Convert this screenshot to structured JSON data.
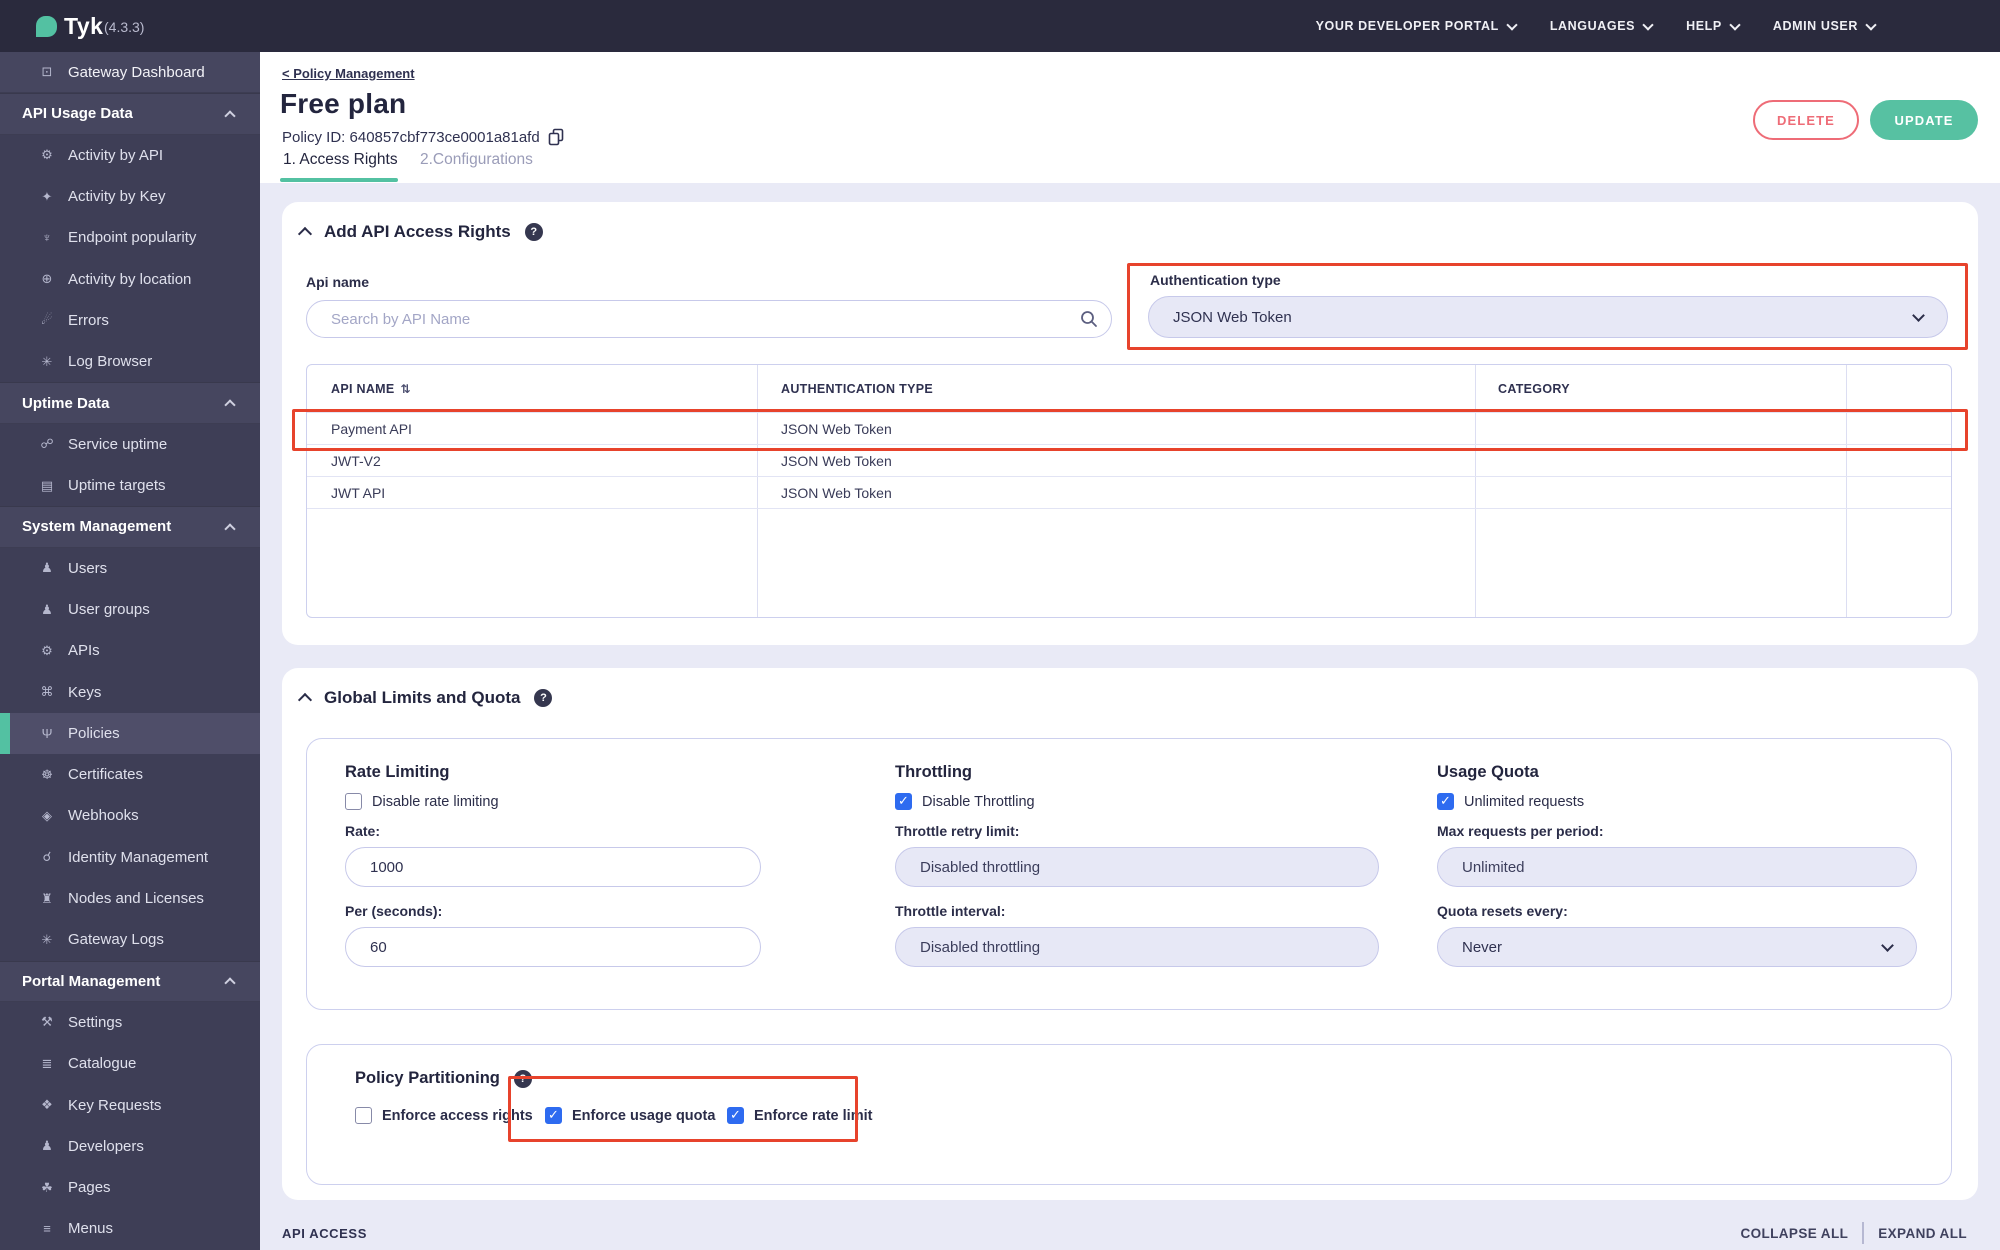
{
  "colors": {
    "accent_teal": "#53c1a2",
    "annotation_red": "#e7432c",
    "delete_red": "#ee6c77",
    "checkbox_blue": "#2e6bf0",
    "topbar": "#2a2a3d",
    "sidebar": "#3e3e56"
  },
  "brand": {
    "logo": "Tyk",
    "version": "(4.3.3)"
  },
  "topnav": {
    "items": [
      {
        "label": "YOUR DEVELOPER PORTAL"
      },
      {
        "label": "LANGUAGES"
      },
      {
        "label": "HELP"
      },
      {
        "label": "ADMIN USER"
      }
    ]
  },
  "sidebar": {
    "rows": [
      {
        "kind": "item",
        "label": "Gateway Dashboard",
        "icon": "monitor-icon",
        "glyph": "⊡"
      },
      {
        "kind": "section",
        "label": "API Usage Data"
      },
      {
        "kind": "sub",
        "label": "Activity by API",
        "icon": "gear-icon",
        "glyph": "⚙"
      },
      {
        "kind": "sub",
        "label": "Activity by Key",
        "icon": "key-icon",
        "glyph": "✦"
      },
      {
        "kind": "sub",
        "label": "Endpoint popularity",
        "icon": "branch-icon",
        "glyph": "♆"
      },
      {
        "kind": "sub",
        "label": "Activity by location",
        "icon": "globe-icon",
        "glyph": "⊕"
      },
      {
        "kind": "sub",
        "label": "Errors",
        "icon": "bomb-icon",
        "glyph": "☄"
      },
      {
        "kind": "sub",
        "label": "Log Browser",
        "icon": "bug-icon",
        "glyph": "✳"
      },
      {
        "kind": "section",
        "label": "Uptime Data"
      },
      {
        "kind": "sub",
        "label": "Service uptime",
        "icon": "link-icon",
        "glyph": "☍"
      },
      {
        "kind": "sub",
        "label": "Uptime targets",
        "icon": "list-icon",
        "glyph": "▤"
      },
      {
        "kind": "section",
        "label": "System Management"
      },
      {
        "kind": "sub",
        "label": "Users",
        "icon": "user-icon",
        "glyph": "♟"
      },
      {
        "kind": "sub",
        "label": "User groups",
        "icon": "users-icon",
        "glyph": "♟"
      },
      {
        "kind": "sub",
        "label": "APIs",
        "icon": "gears-icon",
        "glyph": "⚙"
      },
      {
        "kind": "sub",
        "label": "Keys",
        "icon": "network-icon",
        "glyph": "⌘"
      },
      {
        "kind": "sub",
        "label": "Policies",
        "icon": "plug-icon",
        "glyph": "Ψ",
        "active": true
      },
      {
        "kind": "sub",
        "label": "Certificates",
        "icon": "rosette-icon",
        "glyph": "☸"
      },
      {
        "kind": "sub",
        "label": "Webhooks",
        "icon": "bell-icon",
        "glyph": "◈"
      },
      {
        "kind": "sub",
        "label": "Identity Management",
        "icon": "fingerprint-icon",
        "glyph": "☌"
      },
      {
        "kind": "sub",
        "label": "Nodes and Licenses",
        "icon": "bank-icon",
        "glyph": "♜"
      },
      {
        "kind": "sub",
        "label": "Gateway Logs",
        "icon": "bug-icon",
        "glyph": "✳"
      },
      {
        "kind": "section",
        "label": "Portal Management"
      },
      {
        "kind": "sub",
        "label": "Settings",
        "icon": "wrench-icon",
        "glyph": "⚒"
      },
      {
        "kind": "sub",
        "label": "Catalogue",
        "icon": "catalogue-icon",
        "glyph": "≣"
      },
      {
        "kind": "sub",
        "label": "Key Requests",
        "icon": "paw-icon",
        "glyph": "❖"
      },
      {
        "kind": "sub",
        "label": "Developers",
        "icon": "developers-icon",
        "glyph": "♟"
      },
      {
        "kind": "sub",
        "label": "Pages",
        "icon": "leaf-icon",
        "glyph": "☘"
      },
      {
        "kind": "sub",
        "label": "Menus",
        "icon": "menu-icon",
        "glyph": "≡"
      }
    ]
  },
  "page": {
    "breadcrumb": "< Policy Management",
    "title": "Free plan",
    "policy_id": "Policy ID: 640857cbf773ce0001a81afd",
    "tabs": [
      {
        "label": "1. Access Rights",
        "active": true
      },
      {
        "label": "2.Configurations",
        "active": false
      }
    ],
    "delete_label": "DELETE",
    "update_label": "UPDATE"
  },
  "access_rights": {
    "heading": "Add API Access Rights",
    "api_name_label": "Api name",
    "search_placeholder": "Search by API Name",
    "auth_type_label": "Authentication type",
    "auth_type_value": "JSON Web Token",
    "table": {
      "headers": [
        "API NAME",
        "AUTHENTICATION TYPE",
        "CATEGORY",
        ""
      ],
      "sort_glyph": "⇅",
      "rows": [
        {
          "name": "Payment API",
          "auth": "JSON Web Token",
          "category": ""
        },
        {
          "name": "JWT-V2",
          "auth": "JSON Web Token",
          "category": ""
        },
        {
          "name": "JWT API",
          "auth": "JSON Web Token",
          "category": ""
        }
      ]
    }
  },
  "global_limits": {
    "heading": "Global Limits and Quota",
    "rate": {
      "title": "Rate Limiting",
      "checkbox": "Disable rate limiting",
      "checked": false,
      "rate_label": "Rate:",
      "rate_value": "1000",
      "per_label": "Per (seconds):",
      "per_value": "60"
    },
    "throttling": {
      "title": "Throttling",
      "checkbox": "Disable Throttling",
      "checked": true,
      "retry_label": "Throttle retry limit:",
      "retry_value": "Disabled throttling",
      "interval_label": "Throttle interval:",
      "interval_value": "Disabled throttling"
    },
    "quota": {
      "title": "Usage Quota",
      "checkbox": "Unlimited requests",
      "checked": true,
      "max_label": "Max requests per period:",
      "max_value": "Unlimited",
      "resets_label": "Quota resets every:",
      "resets_value": "Never"
    }
  },
  "partitioning": {
    "heading": "Policy Partitioning",
    "checkboxes": [
      {
        "label": "Enforce access rights",
        "checked": false
      },
      {
        "label": "Enforce usage quota",
        "checked": true
      },
      {
        "label": "Enforce rate limit",
        "checked": true
      }
    ]
  },
  "footer": {
    "left": "API ACCESS",
    "collapse": "COLLAPSE ALL",
    "expand": "EXPAND ALL"
  }
}
